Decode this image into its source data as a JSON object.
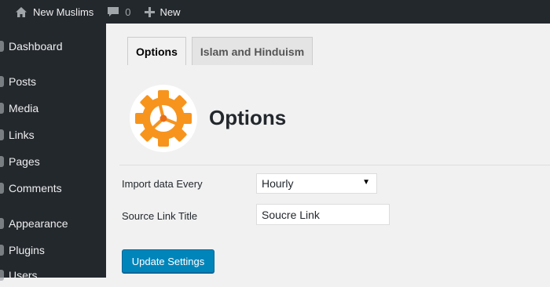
{
  "adminbar": {
    "site_name": "New Muslims",
    "comments_count": "0",
    "new_label": "New"
  },
  "sidebar": {
    "items": [
      {
        "label": "Dashboard"
      },
      {
        "label": "Posts"
      },
      {
        "label": "Media"
      },
      {
        "label": "Links"
      },
      {
        "label": "Pages"
      },
      {
        "label": "Comments"
      },
      {
        "label": "Appearance"
      },
      {
        "label": "Plugins"
      },
      {
        "label": "Users"
      }
    ]
  },
  "tabs": [
    {
      "label": "Options",
      "active": true
    },
    {
      "label": "Islam and Hinduism",
      "active": false
    }
  ],
  "page": {
    "title": "Options",
    "logo_icon": "gear-icon"
  },
  "form": {
    "import_label": "Import data Every",
    "import_value": "Hourly",
    "source_label": "Source Link Title",
    "source_value": "Soucre Link",
    "submit_label": "Update Settings"
  },
  "colors": {
    "adminbar_bg": "#23282d",
    "primary_button": "#0085ba",
    "gear_orange": "#f7941d"
  }
}
